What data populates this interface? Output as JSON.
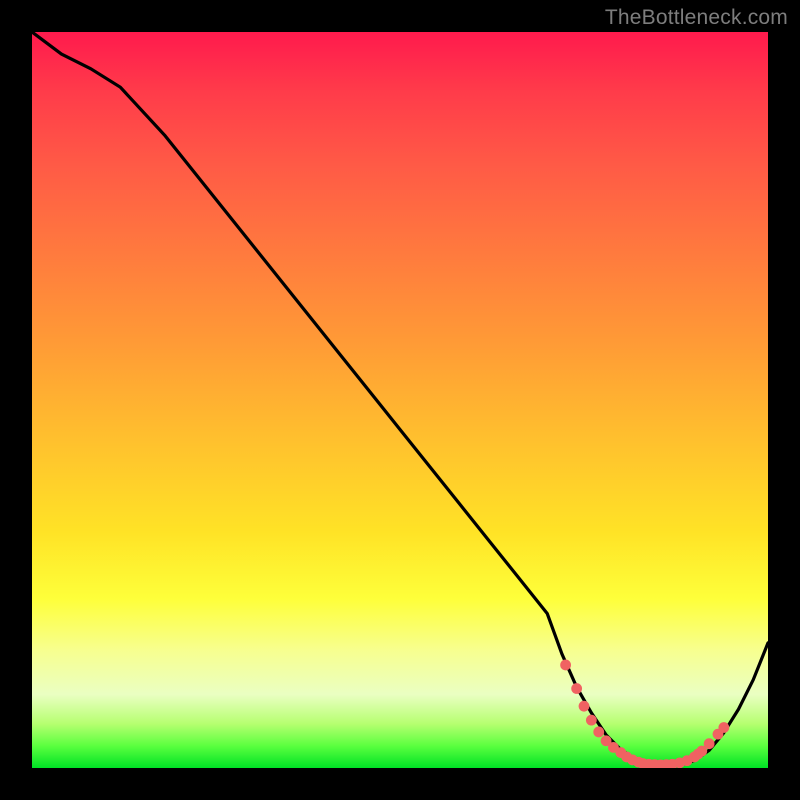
{
  "watermark": {
    "text": "TheBottleneck.com"
  },
  "colors": {
    "background": "#000000",
    "curve": "#000000",
    "marker": "#f06262",
    "watermark": "#7d7d7d"
  },
  "chart_data": {
    "type": "line",
    "title": "",
    "xlabel": "",
    "ylabel": "",
    "xlim": [
      0,
      100
    ],
    "ylim": [
      0,
      100
    ],
    "grid": false,
    "legend": false,
    "series": [
      {
        "name": "curve",
        "x": [
          0,
          4,
          8,
          12,
          18,
          26,
          34,
          42,
          50,
          58,
          62,
          66,
          70,
          72,
          74,
          76,
          78,
          80,
          82,
          84,
          86,
          88,
          90,
          92,
          94,
          96,
          98,
          100
        ],
        "y": [
          100,
          97,
          95,
          92.5,
          86,
          76,
          66,
          56,
          46,
          36,
          31,
          26,
          21,
          15.5,
          11,
          7.5,
          4.5,
          2.5,
          1.2,
          0.6,
          0.4,
          0.5,
          1.0,
          2.4,
          4.8,
          8.0,
          12.0,
          17.0
        ]
      },
      {
        "name": "markers",
        "x": [
          72.5,
          74.0,
          75.0,
          76.0,
          77.0,
          78.0,
          79.0,
          80.0,
          80.8,
          81.6,
          82.4,
          83.0,
          83.8,
          84.6,
          85.4,
          86.2,
          87.0,
          88.0,
          89.0,
          90.0,
          90.5,
          91.0,
          92.0,
          93.2,
          94.0
        ],
        "y": [
          14.0,
          10.8,
          8.4,
          6.5,
          4.9,
          3.7,
          2.8,
          2.1,
          1.5,
          1.1,
          0.8,
          0.6,
          0.5,
          0.45,
          0.42,
          0.45,
          0.5,
          0.7,
          1.0,
          1.5,
          1.9,
          2.3,
          3.3,
          4.6,
          5.5
        ]
      }
    ]
  }
}
